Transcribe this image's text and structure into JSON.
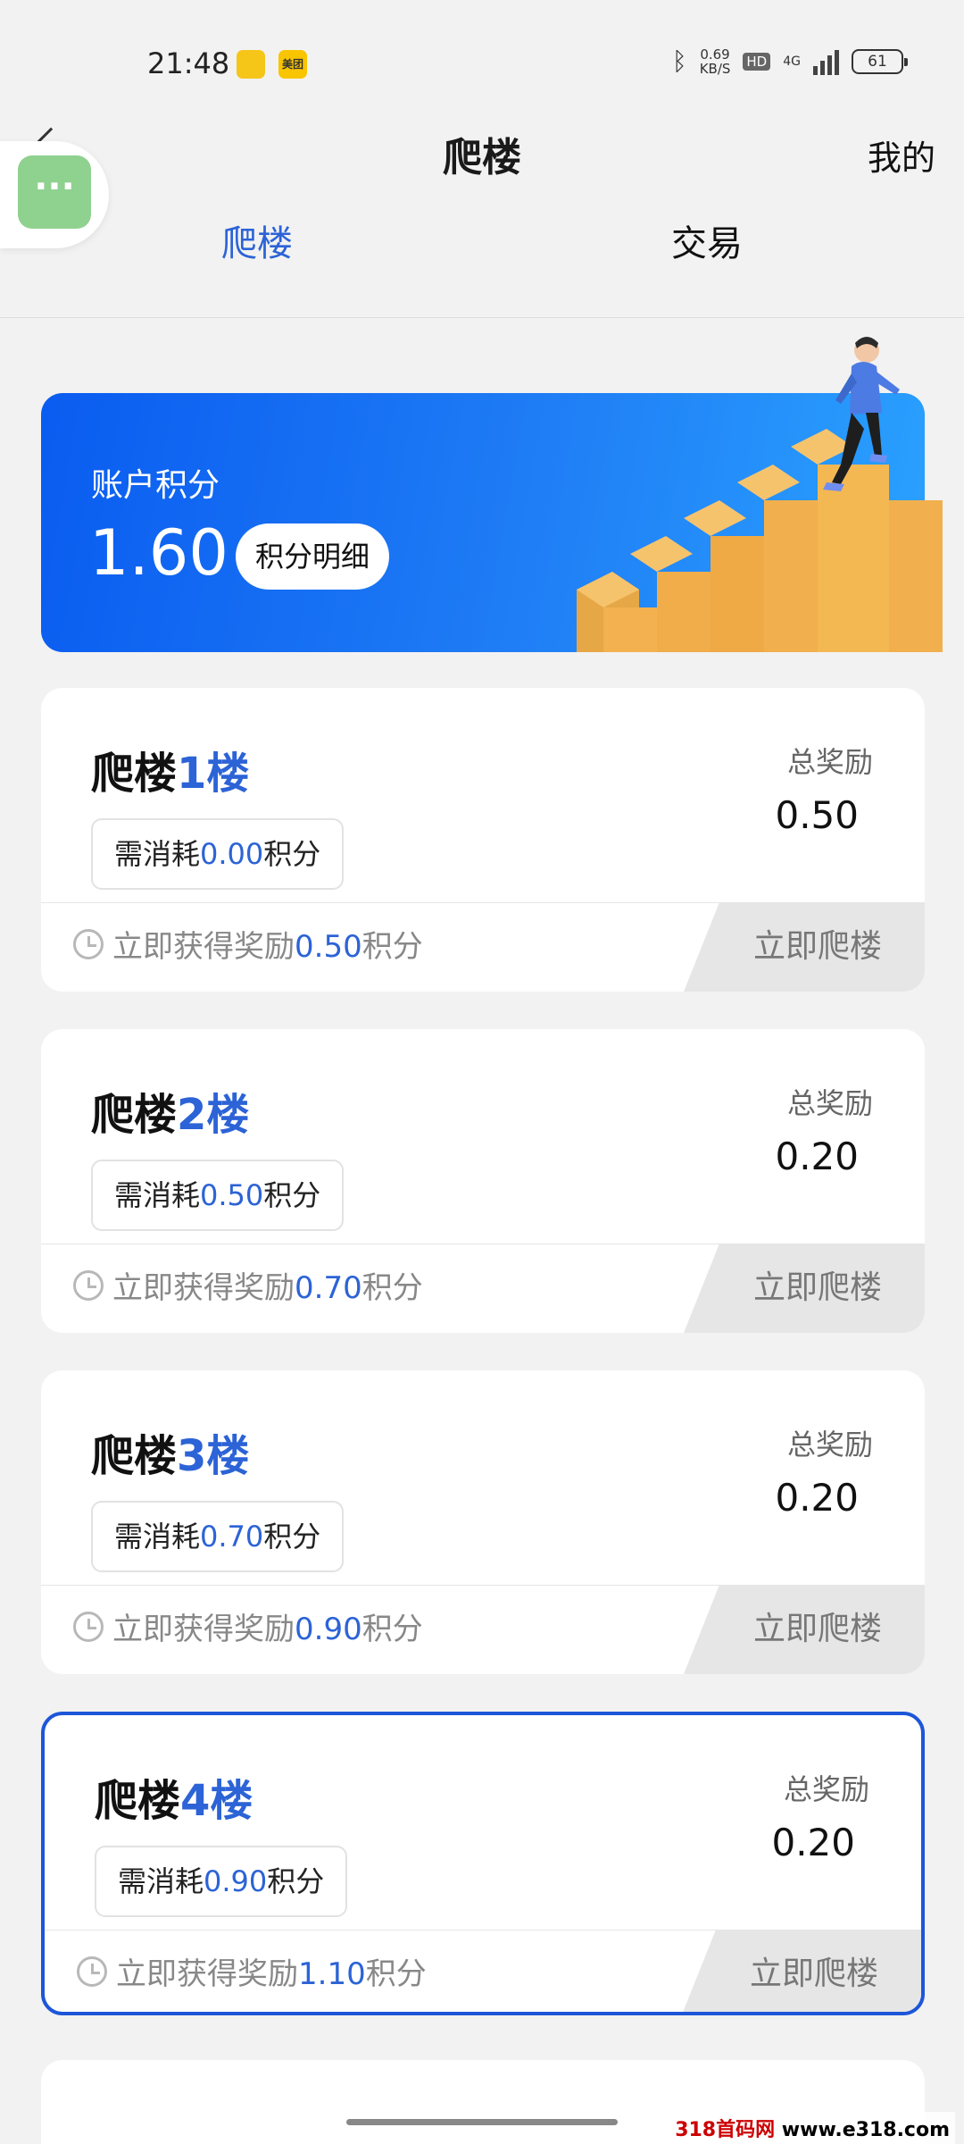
{
  "status_bar": {
    "time": "21:48",
    "notif_app": "美团",
    "net_speed_value": "0.69",
    "net_speed_unit": "KB/S",
    "hd_badge": "HD",
    "network_type": "4G",
    "battery": "61"
  },
  "header": {
    "title": "爬楼",
    "mine_label": "我的",
    "float_button": "···"
  },
  "tabs": [
    {
      "label": "爬楼",
      "active": true
    },
    {
      "label": "交易",
      "active": false
    }
  ],
  "banner": {
    "label": "账户积分",
    "points": "1.60",
    "detail_button": "积分明细"
  },
  "floors": [
    {
      "title_prefix": "爬楼",
      "number": "1",
      "title_suffix": "楼",
      "cost_prefix": "需消耗",
      "cost": "0.00",
      "cost_suffix": "积分",
      "total_label": "总奖励",
      "total": "0.50",
      "reward_prefix": "立即获得奖励",
      "reward": "0.50",
      "reward_suffix": "积分",
      "button": "立即爬楼",
      "active": false
    },
    {
      "title_prefix": "爬楼",
      "number": "2",
      "title_suffix": "楼",
      "cost_prefix": "需消耗",
      "cost": "0.50",
      "cost_suffix": "积分",
      "total_label": "总奖励",
      "total": "0.20",
      "reward_prefix": "立即获得奖励",
      "reward": "0.70",
      "reward_suffix": "积分",
      "button": "立即爬楼",
      "active": false
    },
    {
      "title_prefix": "爬楼",
      "number": "3",
      "title_suffix": "楼",
      "cost_prefix": "需消耗",
      "cost": "0.70",
      "cost_suffix": "积分",
      "total_label": "总奖励",
      "total": "0.20",
      "reward_prefix": "立即获得奖励",
      "reward": "0.90",
      "reward_suffix": "积分",
      "button": "立即爬楼",
      "active": false
    },
    {
      "title_prefix": "爬楼",
      "number": "4",
      "title_suffix": "楼",
      "cost_prefix": "需消耗",
      "cost": "0.90",
      "cost_suffix": "积分",
      "total_label": "总奖励",
      "total": "0.20",
      "reward_prefix": "立即获得奖励",
      "reward": "1.10",
      "reward_suffix": "积分",
      "button": "立即爬楼",
      "active": true
    }
  ],
  "watermark": {
    "site": "318首码网",
    "url": "www.e318.com"
  },
  "colors": {
    "accent_blue": "#2c63d6",
    "banner_start": "#0a5cf0",
    "banner_end": "#2aa2ff",
    "active_border": "#1d56d8"
  },
  "icons": [
    "back-chevron-icon",
    "more-dots-icon",
    "clock-icon",
    "bluetooth-icon",
    "signal-icon",
    "battery-icon"
  ]
}
